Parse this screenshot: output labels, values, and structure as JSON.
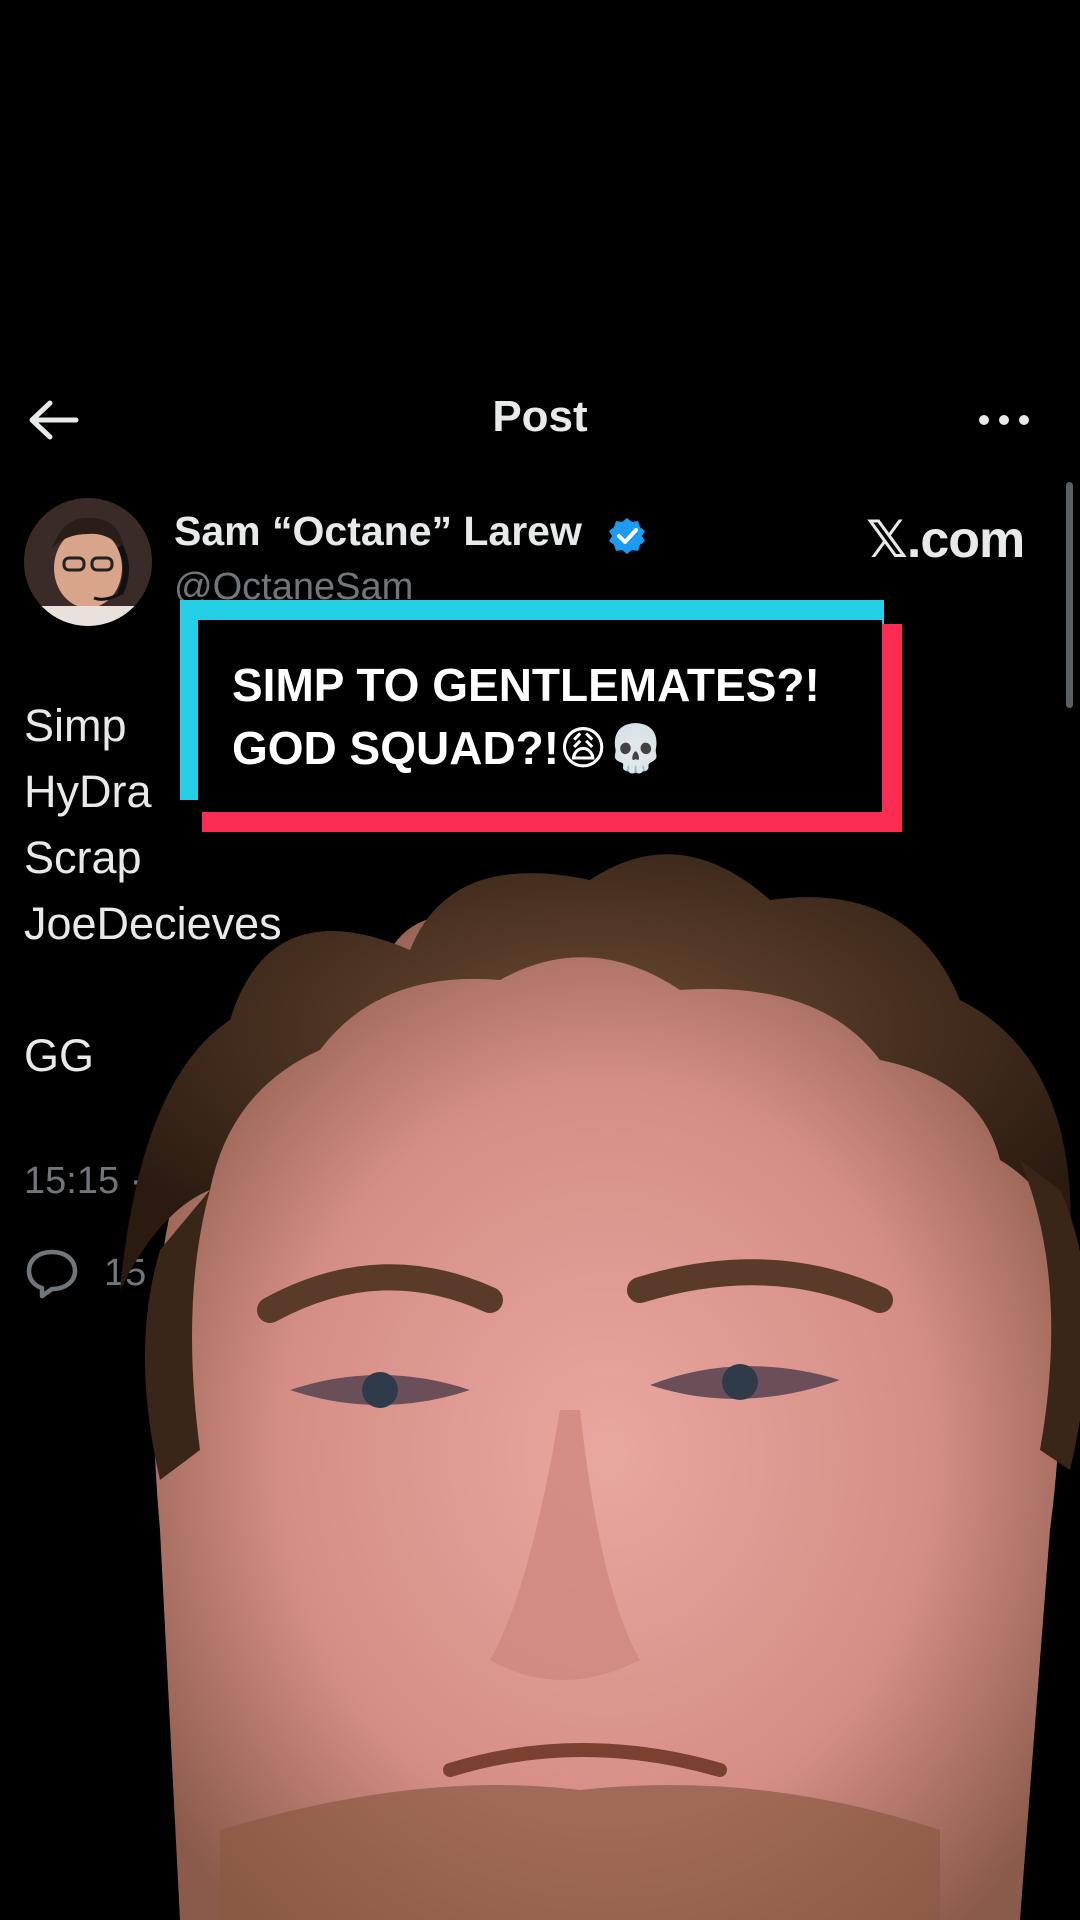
{
  "header": {
    "title": "Post",
    "back_icon": "arrow-left-icon",
    "more_icon": "more-horizontal-icon"
  },
  "author": {
    "name": "Sam “Octane” Larew",
    "handle": "@OctaneSam",
    "verified": true,
    "verified_color": "#1d9bf0"
  },
  "watermark": "𝕏.com",
  "post": {
    "lines": [
      "Simp",
      "HyDra",
      "Scrap",
      "JoeDecieves",
      "GG"
    ],
    "timestamp": "15:15 ·",
    "reply_count": "15"
  },
  "caption": {
    "line1": "SIMP TO GENTLEMATES?!",
    "line2": "GOD SQUAD?!😩💀",
    "colors": {
      "cyan": "#25d0e6",
      "red": "#fd2c55"
    }
  }
}
